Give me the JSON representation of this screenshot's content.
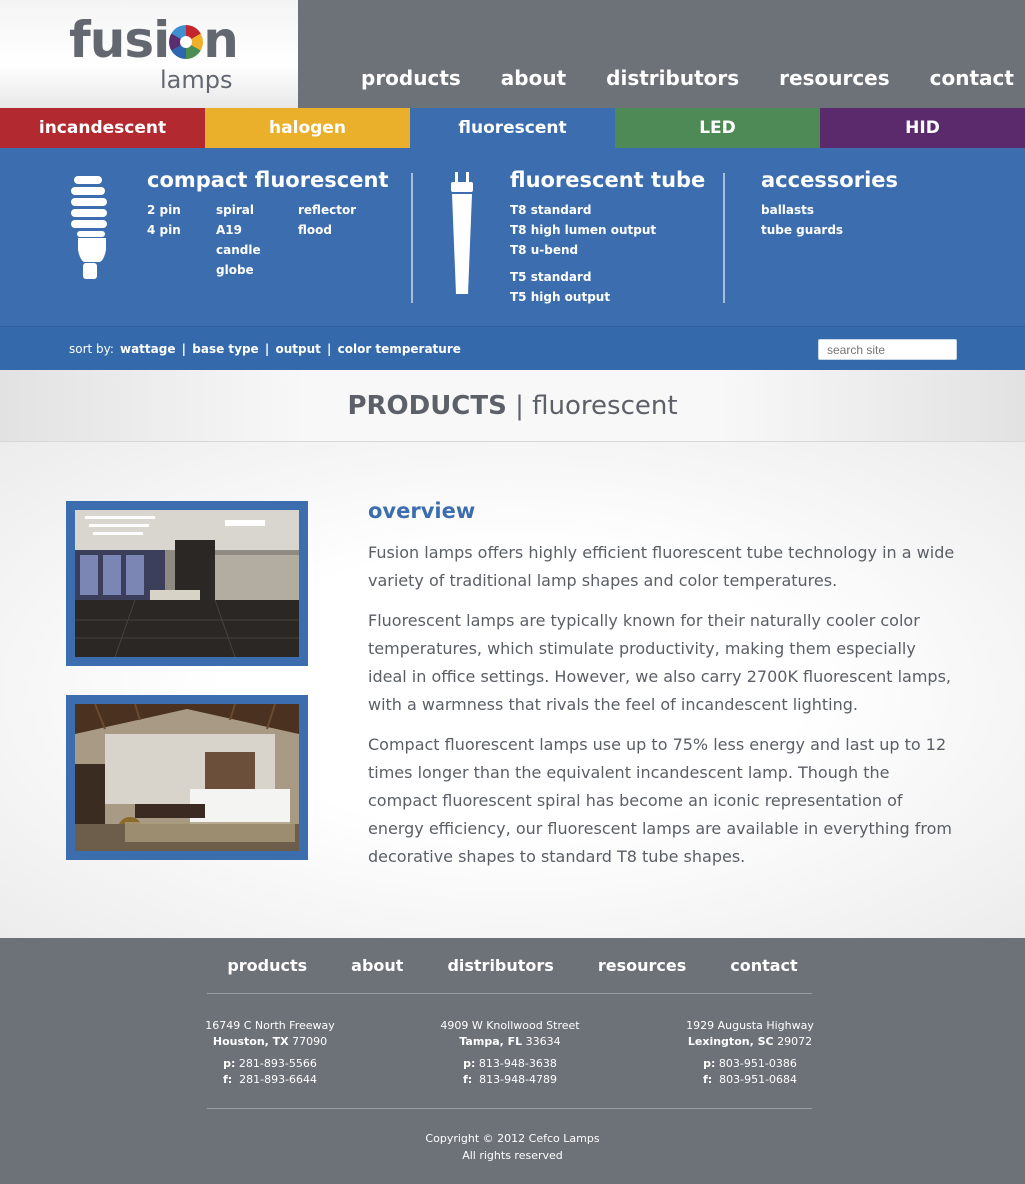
{
  "brand": {
    "name": "fusion",
    "sub": "lamps"
  },
  "main_nav": [
    "products",
    "about",
    "distributors",
    "resources",
    "contact"
  ],
  "categories": [
    {
      "label": "incandescent",
      "color": "#b22a30"
    },
    {
      "label": "halogen",
      "color": "#ebb02b"
    },
    {
      "label": "fluorescent",
      "color": "#3c6eaf"
    },
    {
      "label": "LED",
      "color": "#4d8a55"
    },
    {
      "label": "HID",
      "color": "#5a2a6c"
    }
  ],
  "mega": {
    "compact": {
      "title": "compact fluorescent",
      "col1": [
        "2 pin",
        "4 pin"
      ],
      "col2": [
        "spiral",
        "A19",
        "candle",
        "globe"
      ],
      "col3": [
        "reflector",
        "flood"
      ]
    },
    "tube": {
      "title": "fluorescent tube",
      "group1": [
        "T8 standard",
        "T8 high lumen output",
        "T8 u-bend"
      ],
      "group2": [
        "T5 standard",
        "T5 high output"
      ]
    },
    "accessories": {
      "title": "accessories",
      "items": [
        "ballasts",
        "tube guards"
      ]
    }
  },
  "sort": {
    "label": "sort by:",
    "options": [
      "wattage",
      "base type",
      "output",
      "color temperature"
    ],
    "separator": "|"
  },
  "search": {
    "placeholder": "search site"
  },
  "page_title": {
    "section": "PRODUCTS",
    "separator": "|",
    "sub": "fluorescent"
  },
  "overview": {
    "heading": "overview",
    "paragraphs": [
      "Fusion lamps offers highly efficient fluorescent tube technology in a wide variety of traditional lamp shapes and color temperatures.",
      "Fluorescent lamps are typically known for their naturally cooler color temperatures, which stimulate productivity, making them especially ideal in office settings. However, we also carry 2700K fluorescent lamps, with a warmness that rivals the feel of incandescent lighting.",
      "Compact fluorescent lamps use up to 75% less energy and last up to 12 times longer than the equivalent incandescent lamp.  Though the compact fluorescent spiral has become an iconic representation of energy efficiency, our fluorescent lamps are available in everything from decorative shapes to standard T8 tube shapes."
    ]
  },
  "footer": {
    "nav": [
      "products",
      "about",
      "distributors",
      "resources",
      "contact"
    ],
    "addresses": [
      {
        "street": "16749 C North Freeway",
        "city": "Houston, TX",
        "zip": "77090",
        "phone_label": "p:",
        "phone": "281-893-5566",
        "fax_label": "f:",
        "fax": "281-893-6644"
      },
      {
        "street": "4909 W Knollwood Street",
        "city": "Tampa, FL",
        "zip": "33634",
        "phone_label": "p:",
        "phone": "813-948-3638",
        "fax_label": "f:",
        "fax": "813-948-4789"
      },
      {
        "street": "1929 Augusta Highway",
        "city": "Lexington, SC",
        "zip": "29072",
        "phone_label": "p:",
        "phone": "803-951-0386",
        "fax_label": "f:",
        "fax": "803-951-0684"
      }
    ],
    "copyright": "Copyright © 2012 Cefco Lamps",
    "rights": "All rights reserved"
  }
}
